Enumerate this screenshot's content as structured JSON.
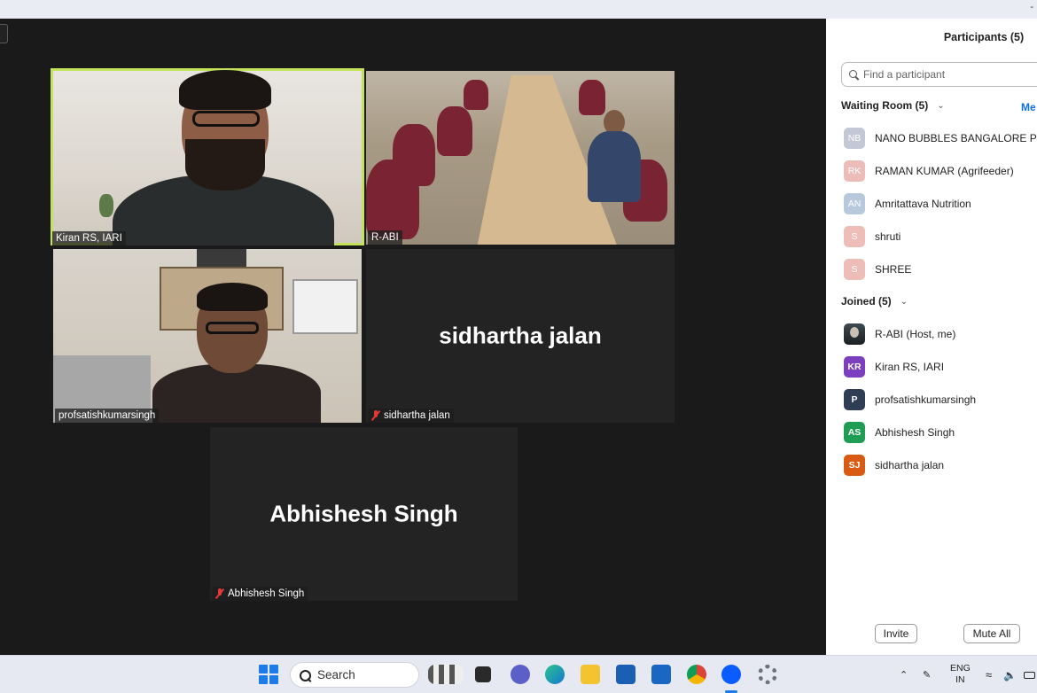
{
  "meeting": {
    "tiles": [
      {
        "name": "Kiran RS, IARI",
        "muted": false,
        "video": true,
        "active": true
      },
      {
        "name": "R-ABI",
        "muted": false,
        "video": true,
        "active": false
      },
      {
        "name": "profsatishkumarsingh",
        "muted": false,
        "video": true,
        "active": false
      },
      {
        "name": "sidhartha jalan",
        "muted": true,
        "video": false,
        "display_name": "sidhartha jalan"
      },
      {
        "name": "Abhishesh Singh",
        "muted": true,
        "video": false,
        "display_name": "Abhishesh Singh"
      }
    ]
  },
  "participants_panel": {
    "title": "Participants (5)",
    "search_placeholder": "Find a participant",
    "waiting_room": {
      "label": "Waiting Room (5)",
      "action": "Me",
      "items": [
        {
          "initials": "NB",
          "name": "NANO BUBBLES BANGALORE PVT LT",
          "color": "#c3c9d4"
        },
        {
          "initials": "RK",
          "name": "RAMAN KUMAR (Agrifeeder)",
          "color": "#ecbcb8"
        },
        {
          "initials": "AN",
          "name": "Amritattava Nutrition",
          "color": "#b9c9dd"
        },
        {
          "initials": "S",
          "name": "shruti",
          "color": "#eebdb8"
        },
        {
          "initials": "S",
          "name": "SHREE",
          "color": "#eebdb8"
        }
      ]
    },
    "joined": {
      "label": "Joined (5)",
      "items": [
        {
          "initials": "",
          "name": "R-ABI (Host, me)",
          "photo": true
        },
        {
          "initials": "KR",
          "name": "Kiran RS, IARI",
          "color": "#7b3fbf"
        },
        {
          "initials": "P",
          "name": "profsatishkumarsingh",
          "color": "#2f3e55"
        },
        {
          "initials": "AS",
          "name": "Abhishesh Singh",
          "color": "#1f9d55"
        },
        {
          "initials": "SJ",
          "name": "sidhartha jalan",
          "color": "#d95a12"
        }
      ]
    },
    "invite_label": "Invite",
    "mute_all_label": "Mute All"
  },
  "taskbar": {
    "search_label": "Search",
    "lang_top": "ENG",
    "lang_bottom": "IN",
    "titlebar_symbol": "-"
  }
}
